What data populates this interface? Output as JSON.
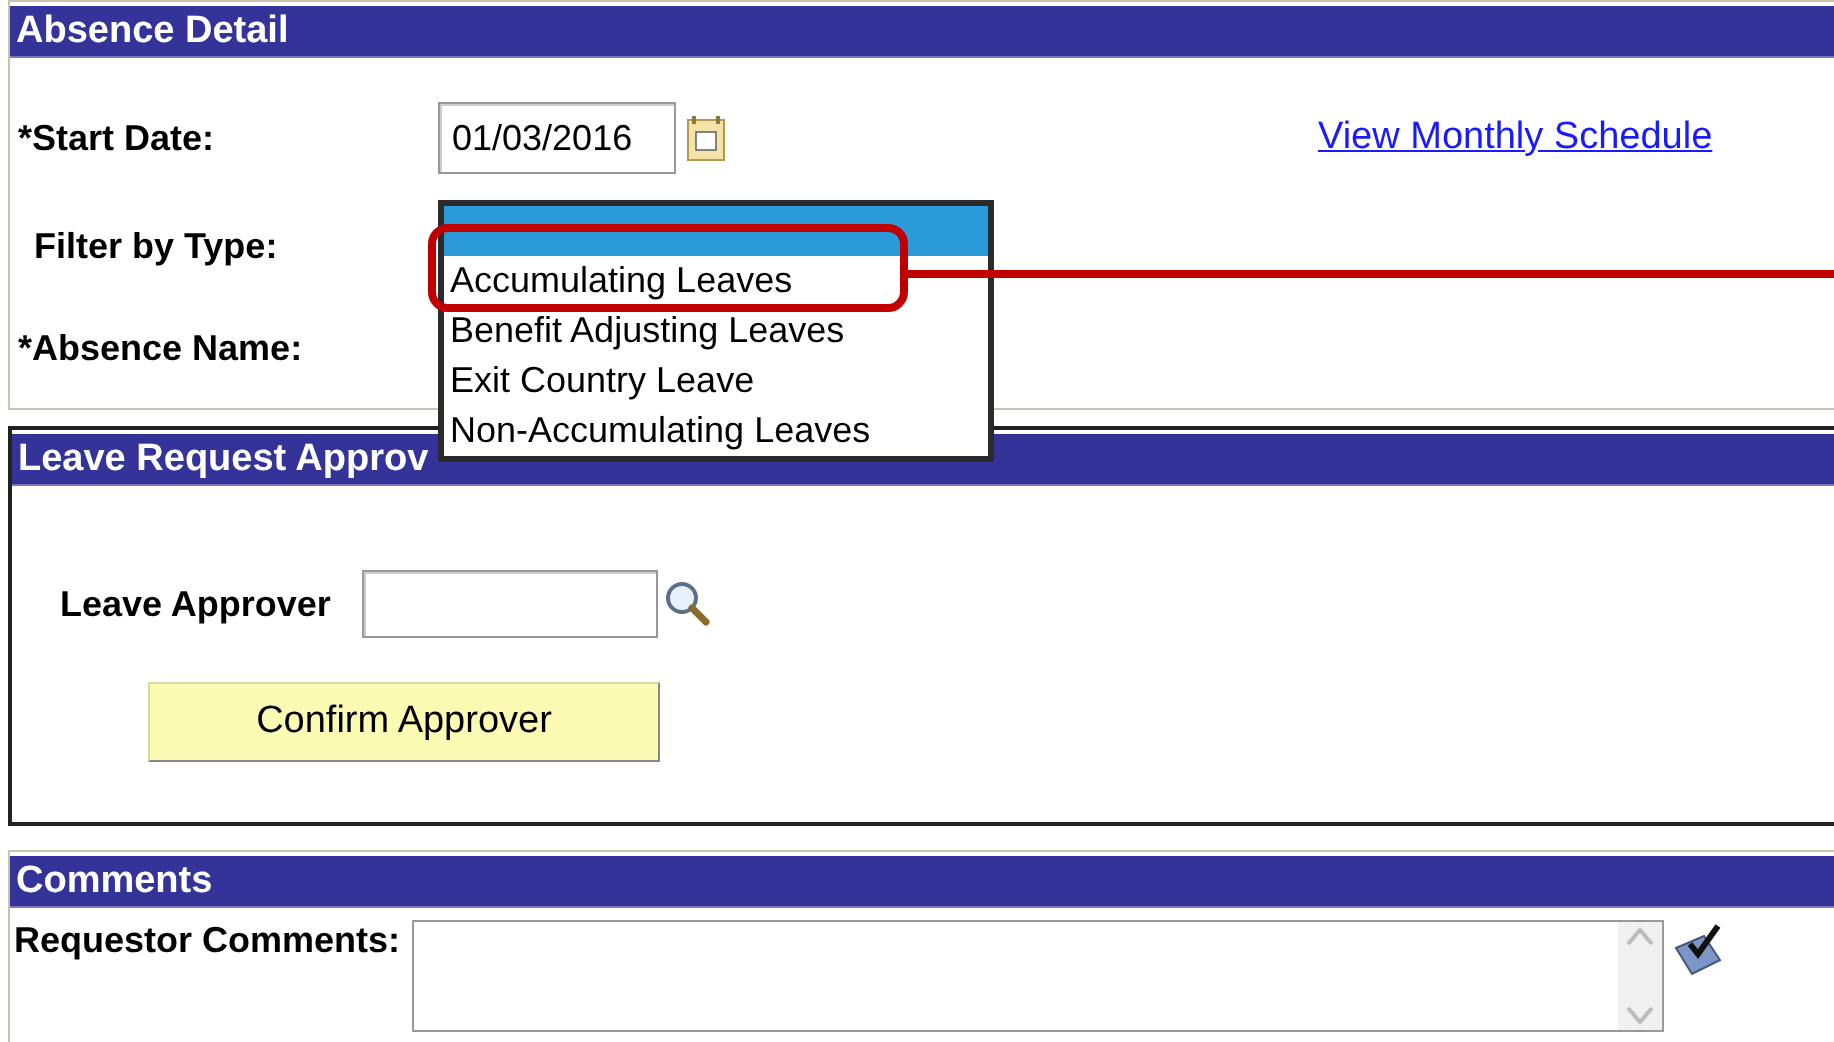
{
  "absence_detail": {
    "title": "Absence Detail",
    "start_date": {
      "label": "*Start Date:",
      "value": "01/03/2016"
    },
    "schedule_link": "View Monthly Schedule",
    "filter_by_type": {
      "label": "Filter by Type:",
      "dropdown": {
        "open": true,
        "blank_option_highlighted": true,
        "options": [
          {
            "label": "Accumulating Leaves",
            "selected": false
          },
          {
            "label": "Benefit Adjusting Leaves",
            "selected": false
          },
          {
            "label": "Exit Country Leave",
            "selected": false
          },
          {
            "label": "Non-Accumulating Leaves",
            "selected": false
          }
        ]
      }
    },
    "absence_name": {
      "label": "*Absence Name:"
    }
  },
  "leave_request_approver": {
    "title": "Leave Request Approv",
    "approver": {
      "label": "Leave Approver"
    },
    "confirm_button": "Confirm Approver"
  },
  "comments": {
    "title": "Comments",
    "requestor": {
      "label": "Requestor Comments:"
    }
  },
  "callout": {
    "visible": true
  }
}
